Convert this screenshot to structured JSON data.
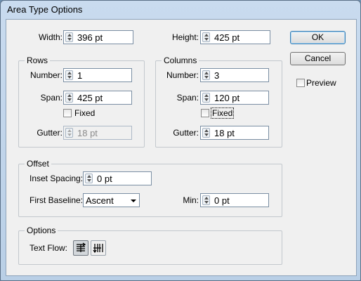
{
  "window": {
    "title": "Area Type Options"
  },
  "dimensions": {
    "width_label": "Width:",
    "width_value": "396 pt",
    "height_label": "Height:",
    "height_value": "425 pt"
  },
  "rows": {
    "title": "Rows",
    "number_label": "Number:",
    "number_value": "1",
    "span_label": "Span:",
    "span_value": "425 pt",
    "fixed_label": "Fixed",
    "fixed_checked": false,
    "gutter_label": "Gutter:",
    "gutter_value": "18 pt"
  },
  "columns": {
    "title": "Columns",
    "number_label": "Number:",
    "number_value": "3",
    "span_label": "Span:",
    "span_value": "120 pt",
    "fixed_label": "Fixed",
    "fixed_checked": false,
    "gutter_label": "Gutter:",
    "gutter_value": "18 pt"
  },
  "offset": {
    "title": "Offset",
    "inset_label": "Inset Spacing:",
    "inset_value": "0 pt",
    "baseline_label": "First Baseline:",
    "baseline_value": "Ascent",
    "min_label": "Min:",
    "min_value": "0 pt"
  },
  "options": {
    "title": "Options",
    "text_flow_label": "Text Flow:",
    "text_flow_icons": [
      "text-flow-by-rows-icon",
      "text-flow-by-columns-icon"
    ]
  },
  "buttons": {
    "ok": "OK",
    "cancel": "Cancel"
  },
  "preview": {
    "label": "Preview",
    "checked": false
  },
  "colors": {
    "accent": "#3c7fb1",
    "title_bar": "#c9dbef",
    "dialog_bg": "#f0f0f0"
  }
}
